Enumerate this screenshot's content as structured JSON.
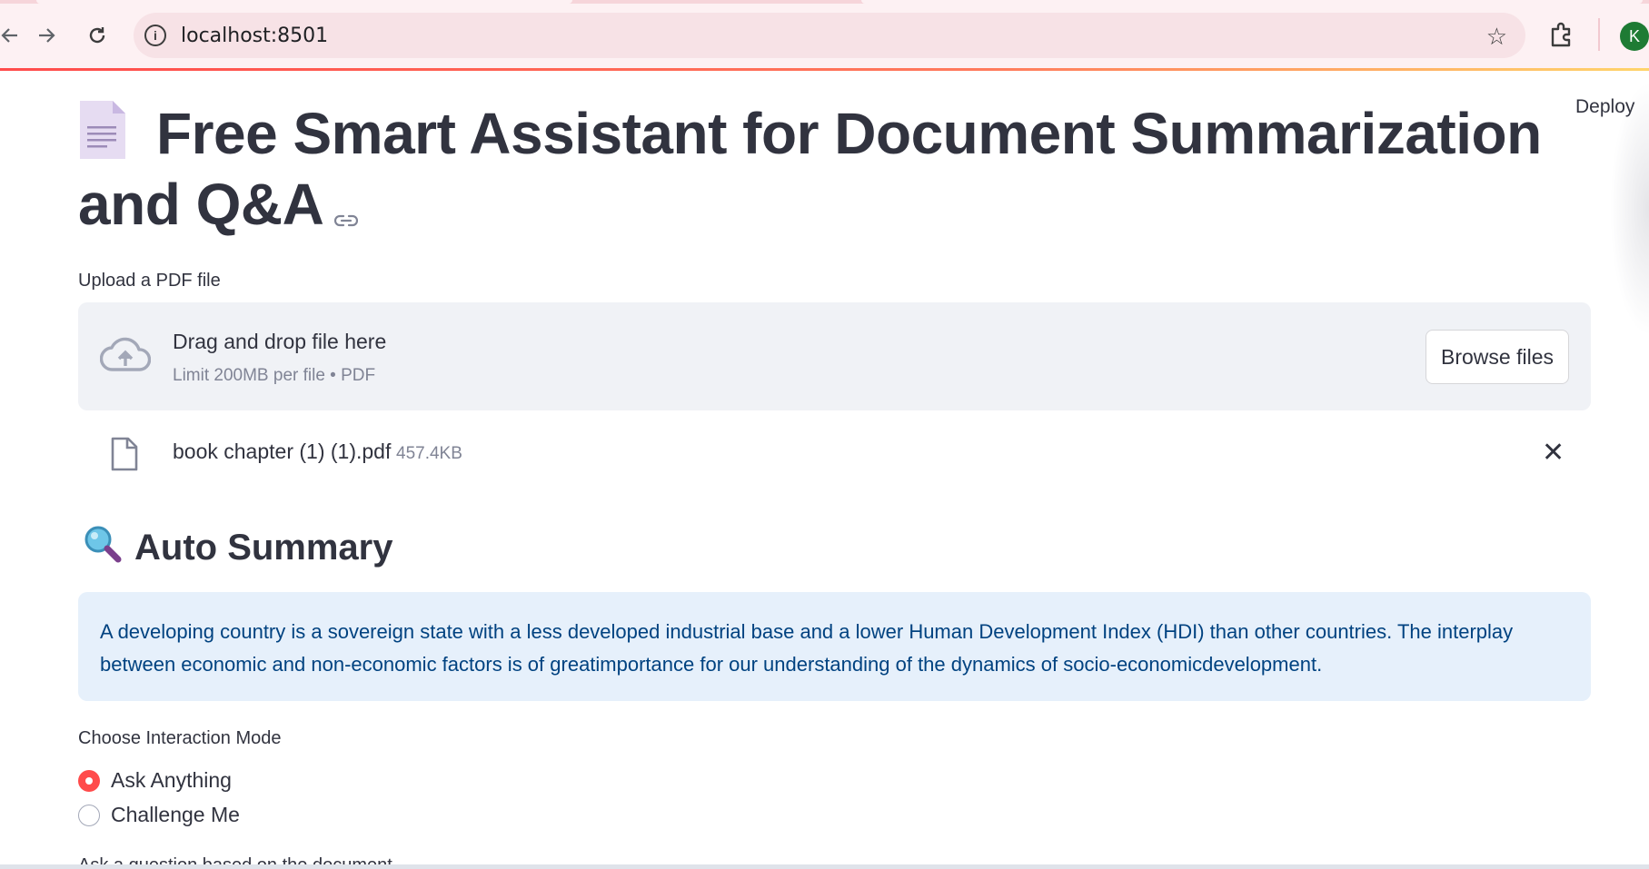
{
  "browser": {
    "url": "localhost:8501",
    "profile_initial": "K"
  },
  "app": {
    "deploy_label": "Deploy",
    "title": "Free Smart Assistant for Document Summarization and Q&A",
    "upload_label": "Upload a PDF file",
    "dropzone": {
      "title": "Drag and drop file here",
      "subtitle": "Limit 200MB per file • PDF",
      "browse_label": "Browse files"
    },
    "uploaded_file": {
      "name": "book chapter (1) (1).pdf",
      "size": "457.4KB"
    },
    "summary_heading": "Auto Summary",
    "summary_text": "A developing country is a sovereign state with a less developed industrial base and a lower Human Development Index (HDI) than other countries. The interplay between economic and non-economic factors is of greatimportance for our understanding of the dynamics of socio-economicdevelopment.",
    "mode_label": "Choose Interaction Mode",
    "modes": [
      {
        "label": "Ask Anything",
        "selected": true
      },
      {
        "label": "Challenge Me",
        "selected": false
      }
    ],
    "next_label_partial": "Ask a question based on the document"
  },
  "colors": {
    "accent": "#ff4b4b",
    "info_bg": "#e6f0fb",
    "info_text": "#004280",
    "dropzone_bg": "#f0f2f6",
    "chrome_bg": "#fdf1f3"
  },
  "icons": [
    "back-arrow-icon",
    "forward-arrow-icon",
    "reload-icon",
    "info-icon",
    "star-icon",
    "extensions-icon",
    "document-emoji-icon",
    "link-icon",
    "cloud-upload-icon",
    "file-icon",
    "close-icon",
    "magnifier-emoji-icon"
  ]
}
